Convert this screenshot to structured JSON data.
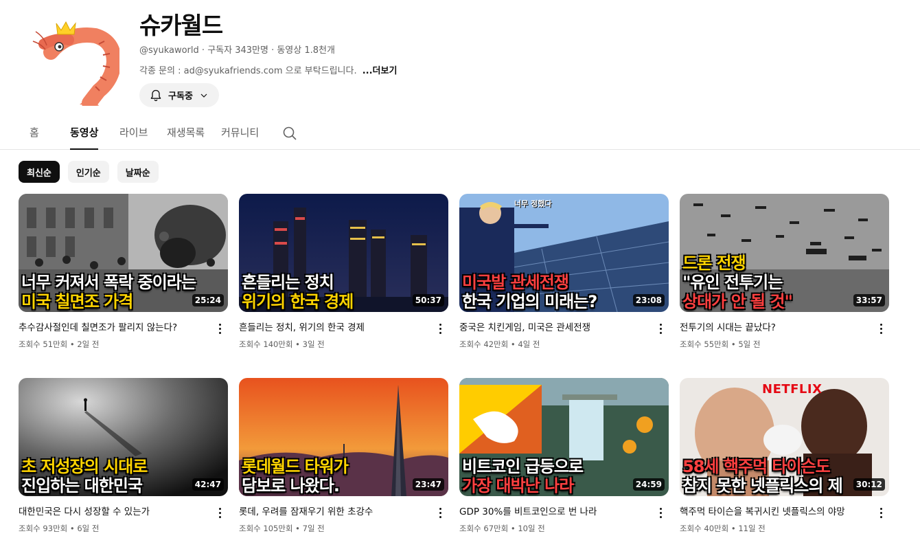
{
  "channel": {
    "name": "슈카월드",
    "handle": "@syukaworld",
    "subscribers": "구독자 343만명",
    "video_count": "동영상 1.8천개",
    "description": "각종 문의 : ad@syukafriends.com 으로 부탁드립니다.",
    "more_label": "...더보기",
    "subscribe_label": "구독중"
  },
  "tabs": [
    {
      "label": "홈"
    },
    {
      "label": "동영상"
    },
    {
      "label": "라이브"
    },
    {
      "label": "재생목록"
    },
    {
      "label": "커뮤니티"
    }
  ],
  "chips": [
    {
      "label": "최신순"
    },
    {
      "label": "인기순"
    },
    {
      "label": "날짜순"
    }
  ],
  "videos": [
    {
      "title": "추수감사절인데 칠면조가 팔리지 않는다?",
      "views": "조회수 51만회",
      "age": "2일 전",
      "duration": "25:24",
      "caption1": "너무 커져서 폭락 중이라는",
      "caption2": "미국 칠면조 가격",
      "c1": "#ffffff",
      "c2": "#ffd400"
    },
    {
      "title": "흔들리는 정치, 위기의 한국 경제",
      "views": "조회수 140만회",
      "age": "3일 전",
      "duration": "50:37",
      "caption1": "흔들리는 정치",
      "caption2": "위기의 한국 경제",
      "c1": "#ffffff",
      "c2": "#ffd400"
    },
    {
      "title": "중국은 치킨게임, 미국은 관세전쟁",
      "views": "조회수 42만회",
      "age": "4일 전",
      "duration": "23:08",
      "caption1": "미국발 관세전쟁",
      "caption2": "한국 기업의 미래는?",
      "c1": "#ff4040",
      "c2": "#ffffff",
      "top_caption": "너무 정했다"
    },
    {
      "title": "전투기의 시대는 끝났다?",
      "views": "조회수 55만회",
      "age": "5일 전",
      "duration": "33:57",
      "caption0": "드론 전쟁",
      "caption1": "\"유인 전투기는",
      "caption2": "상대가 안 될 것\"",
      "c0": "#ffd400",
      "c1": "#ffffff",
      "c2": "#ff4040"
    },
    {
      "title": "대한민국은 다시 성장할 수 있는가",
      "views": "조회수 93만회",
      "age": "6일 전",
      "duration": "42:47",
      "caption1": "초 저성장의 시대로",
      "caption2": "진입하는 대한민국",
      "c1": "#ffd400",
      "c2": "#ffffff"
    },
    {
      "title": "롯데, 우려를 잠재우기 위한 초강수",
      "views": "조회수 105만회",
      "age": "7일 전",
      "duration": "23:47",
      "caption1": "롯데월드 타워가",
      "caption2": "담보로 나왔다.",
      "c1": "#ffd400",
      "c2": "#ffffff"
    },
    {
      "title": "GDP 30%를 비트코인으로 번 나라",
      "views": "조회수 67만회",
      "age": "10일 전",
      "duration": "24:59",
      "caption1": "비트코인 급등으로",
      "caption2": "가장 대박난 나라",
      "c1": "#ffffff",
      "c2": "#ff4040"
    },
    {
      "title": "핵주먹 타이슨을 복귀시킨 넷플릭스의 야망",
      "views": "조회수 40만회",
      "age": "11일 전",
      "duration": "30:12",
      "caption1": "58세 핵주먹 타이슨도",
      "caption2": "참지 못한 넷플릭스의 제",
      "c1": "#ff4040",
      "c2": "#ffffff",
      "brand": "NETFLIX"
    }
  ],
  "colors": {
    "accent": "#0f0f0f",
    "secondary_text": "#606060",
    "chip_bg": "#f2f2f2",
    "caption_yellow": "#ffd400",
    "caption_red": "#ff4040"
  },
  "icons": {
    "avatar": "shrimp-logo",
    "bell": "bell-icon",
    "chevron": "chevron-down-icon",
    "search": "search-icon",
    "more": "more-vert-icon"
  }
}
